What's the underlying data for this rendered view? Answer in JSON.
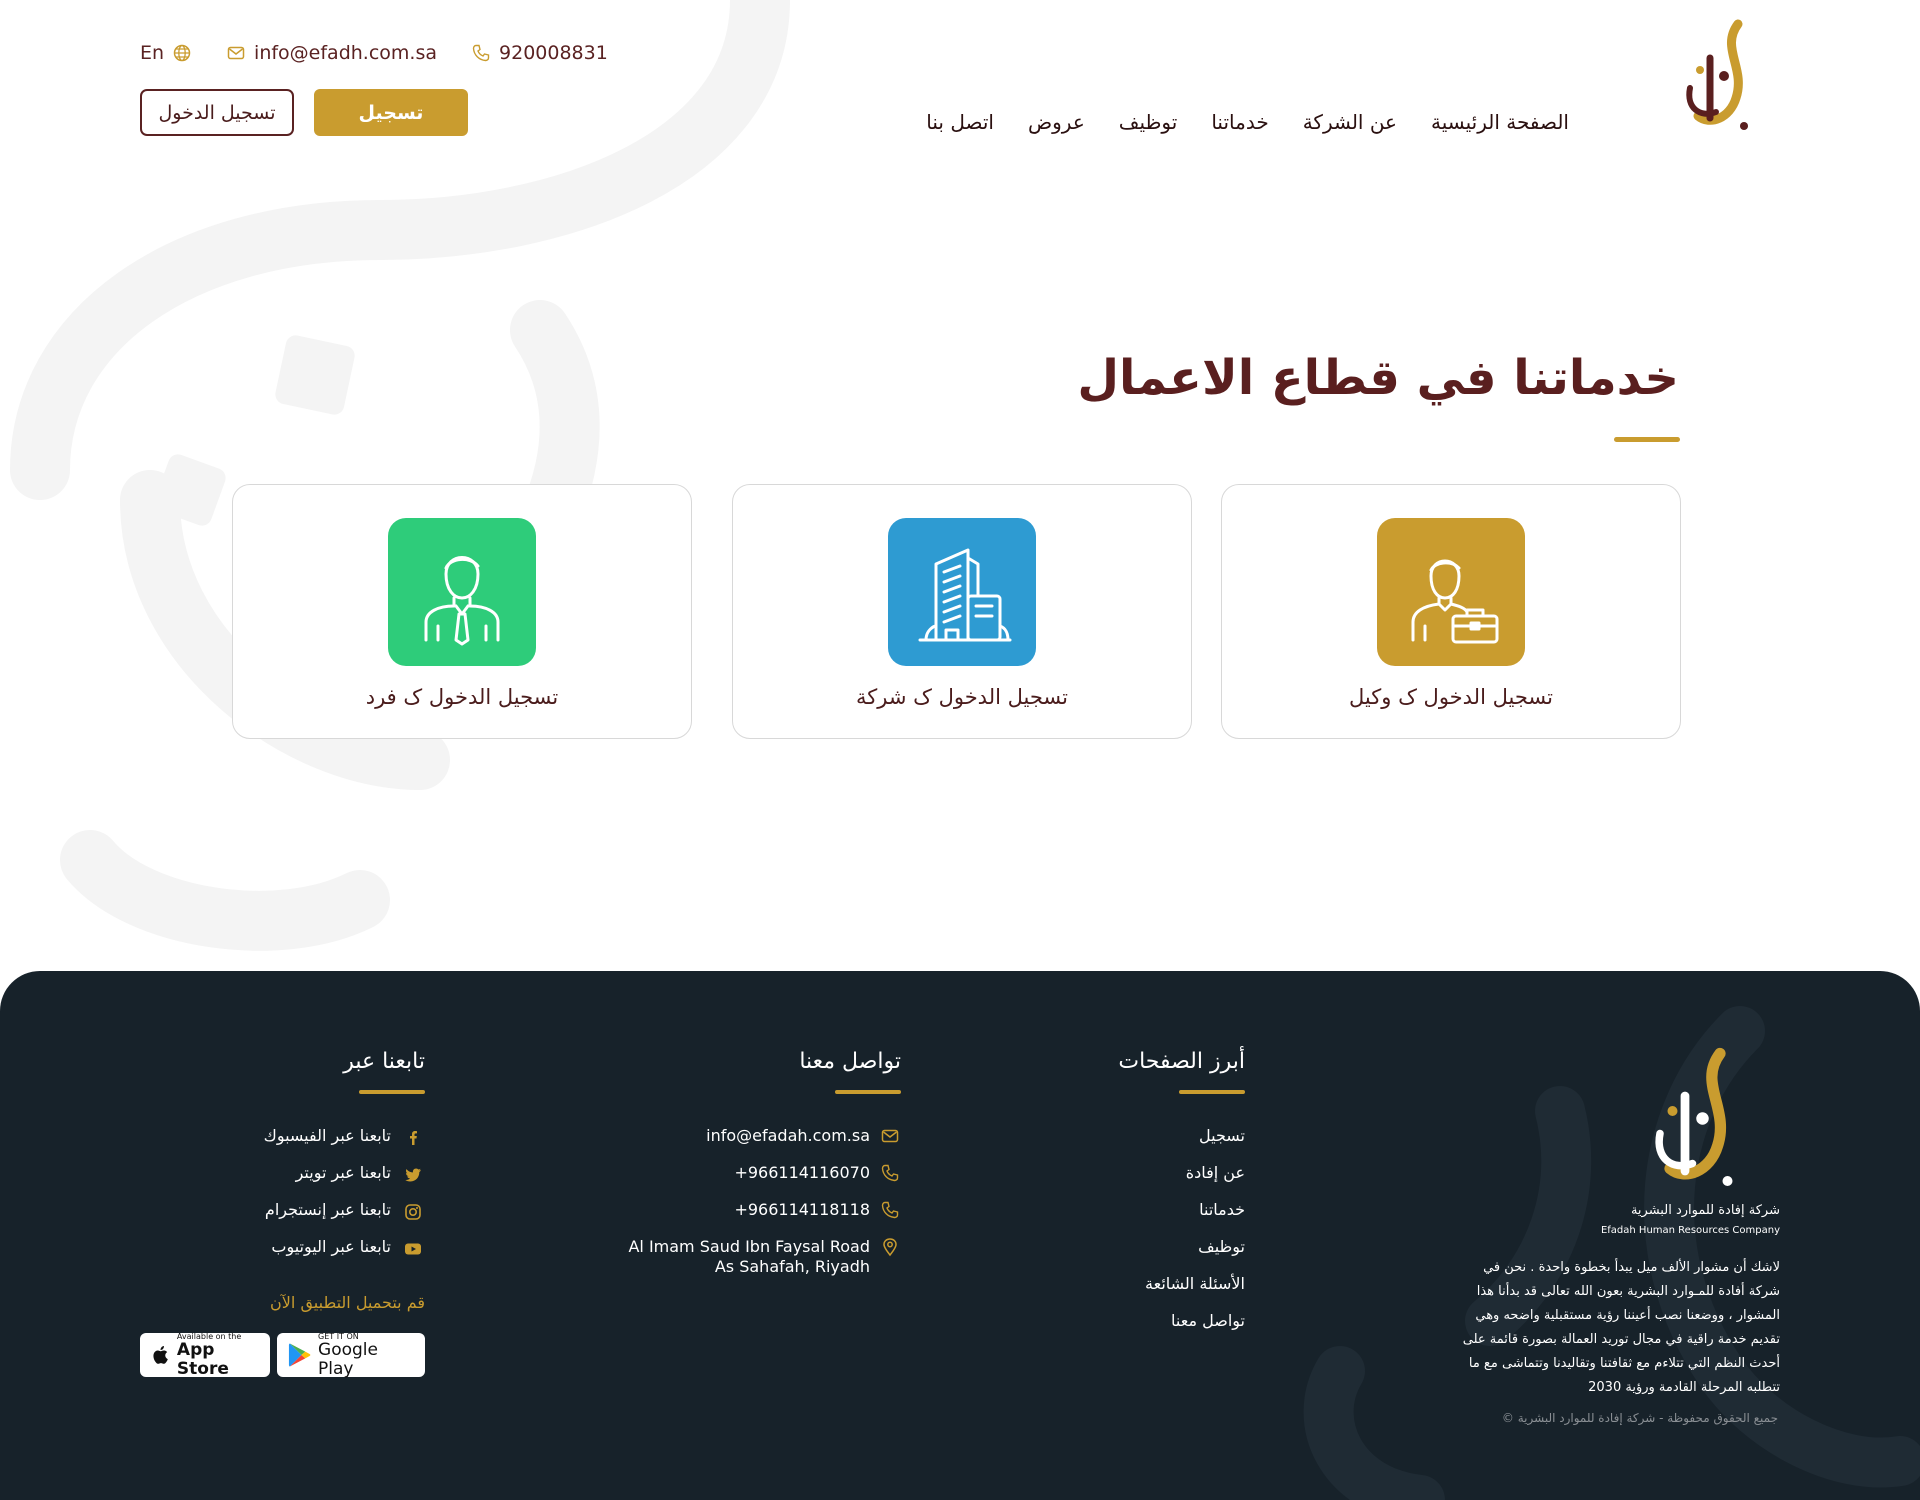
{
  "colors": {
    "gold": "#c99c2f",
    "maroon": "#5a1f1f",
    "green": "#2ecc7a",
    "blue": "#2e9bd2",
    "footer_bg": "#17222a"
  },
  "header": {
    "phone": "920008831",
    "email": "info@efadh.com.sa",
    "language": "En",
    "register_label": "تسجيل",
    "login_label": "تسجيل الدخول",
    "nav": [
      "الصفحة الرئيسية",
      "عن الشركة",
      "خدماتنا",
      "توظيف",
      "عروض",
      "اتصل بنا"
    ]
  },
  "section": {
    "title": "خدماتنا في قطاع الاعمال",
    "cards": [
      {
        "label": "تسجيل الدخول ک وكيل",
        "icon": "agent-briefcase-icon"
      },
      {
        "label": "تسجيل الدخول ک شركة",
        "icon": "company-building-icon"
      },
      {
        "label": "تسجيل الدخول ک فرد",
        "icon": "individual-person-icon"
      }
    ]
  },
  "footer": {
    "company_ar": "شركة إفادة للموارد البشرية",
    "company_en": "Efadah Human Resources Company",
    "about": "لاشك أن مشوار الألف ميل يبدأ بخطوة واحدة . نحن في شركة أفادة للمـوارد البشرية بعون الله تعالى قد بدأنا هذا المشوار ، ووضعنا نصب أعيننا رؤية مستقبلية واضحه وهي تقديم خدمة راقية في مجال توريد العمالة بصورة قائمة على أحدث النظم التي تتلاءم مع ثقافتنا وتقاليدنا وتتماشى مع ما تتطلبه المرحلة القادمة ورؤية 2030",
    "copyright": "جميع الحقوق محفوظة - شركة إفادة للموارد البشرية ©",
    "pages_title": "أبرز الصفحات",
    "pages": [
      "تسجيل",
      "عن إفادة",
      "خدماتنا",
      "توظيف",
      "الأسئلة الشائعة",
      "تواصل معنا"
    ],
    "contact_title": "تواصل معنا",
    "contact_email": "info@efadah.com.sa",
    "contact_phone1": "+966114116070",
    "contact_phone2": "+966114118118",
    "address_line1": "Al Imam Saud Ibn Faysal Road",
    "address_line2": "As Sahafah, Riyadh",
    "follow_title": "تابعنا عبر",
    "social": [
      {
        "label": "تابعنا عبر الفيسبوك",
        "icon": "facebook-icon"
      },
      {
        "label": "تابعنا عبر تويتر",
        "icon": "twitter-icon"
      },
      {
        "label": "تابعنا عبر إنستجرام",
        "icon": "instagram-icon"
      },
      {
        "label": "تابعنا عبر اليوتيوب",
        "icon": "youtube-icon"
      }
    ],
    "app_label": "قم بتحميل التطبيق الآن",
    "appstore_small": "Available on the",
    "appstore_big": "App Store",
    "googleplay_small": "GET IT ON",
    "googleplay_big": "Google Play"
  }
}
